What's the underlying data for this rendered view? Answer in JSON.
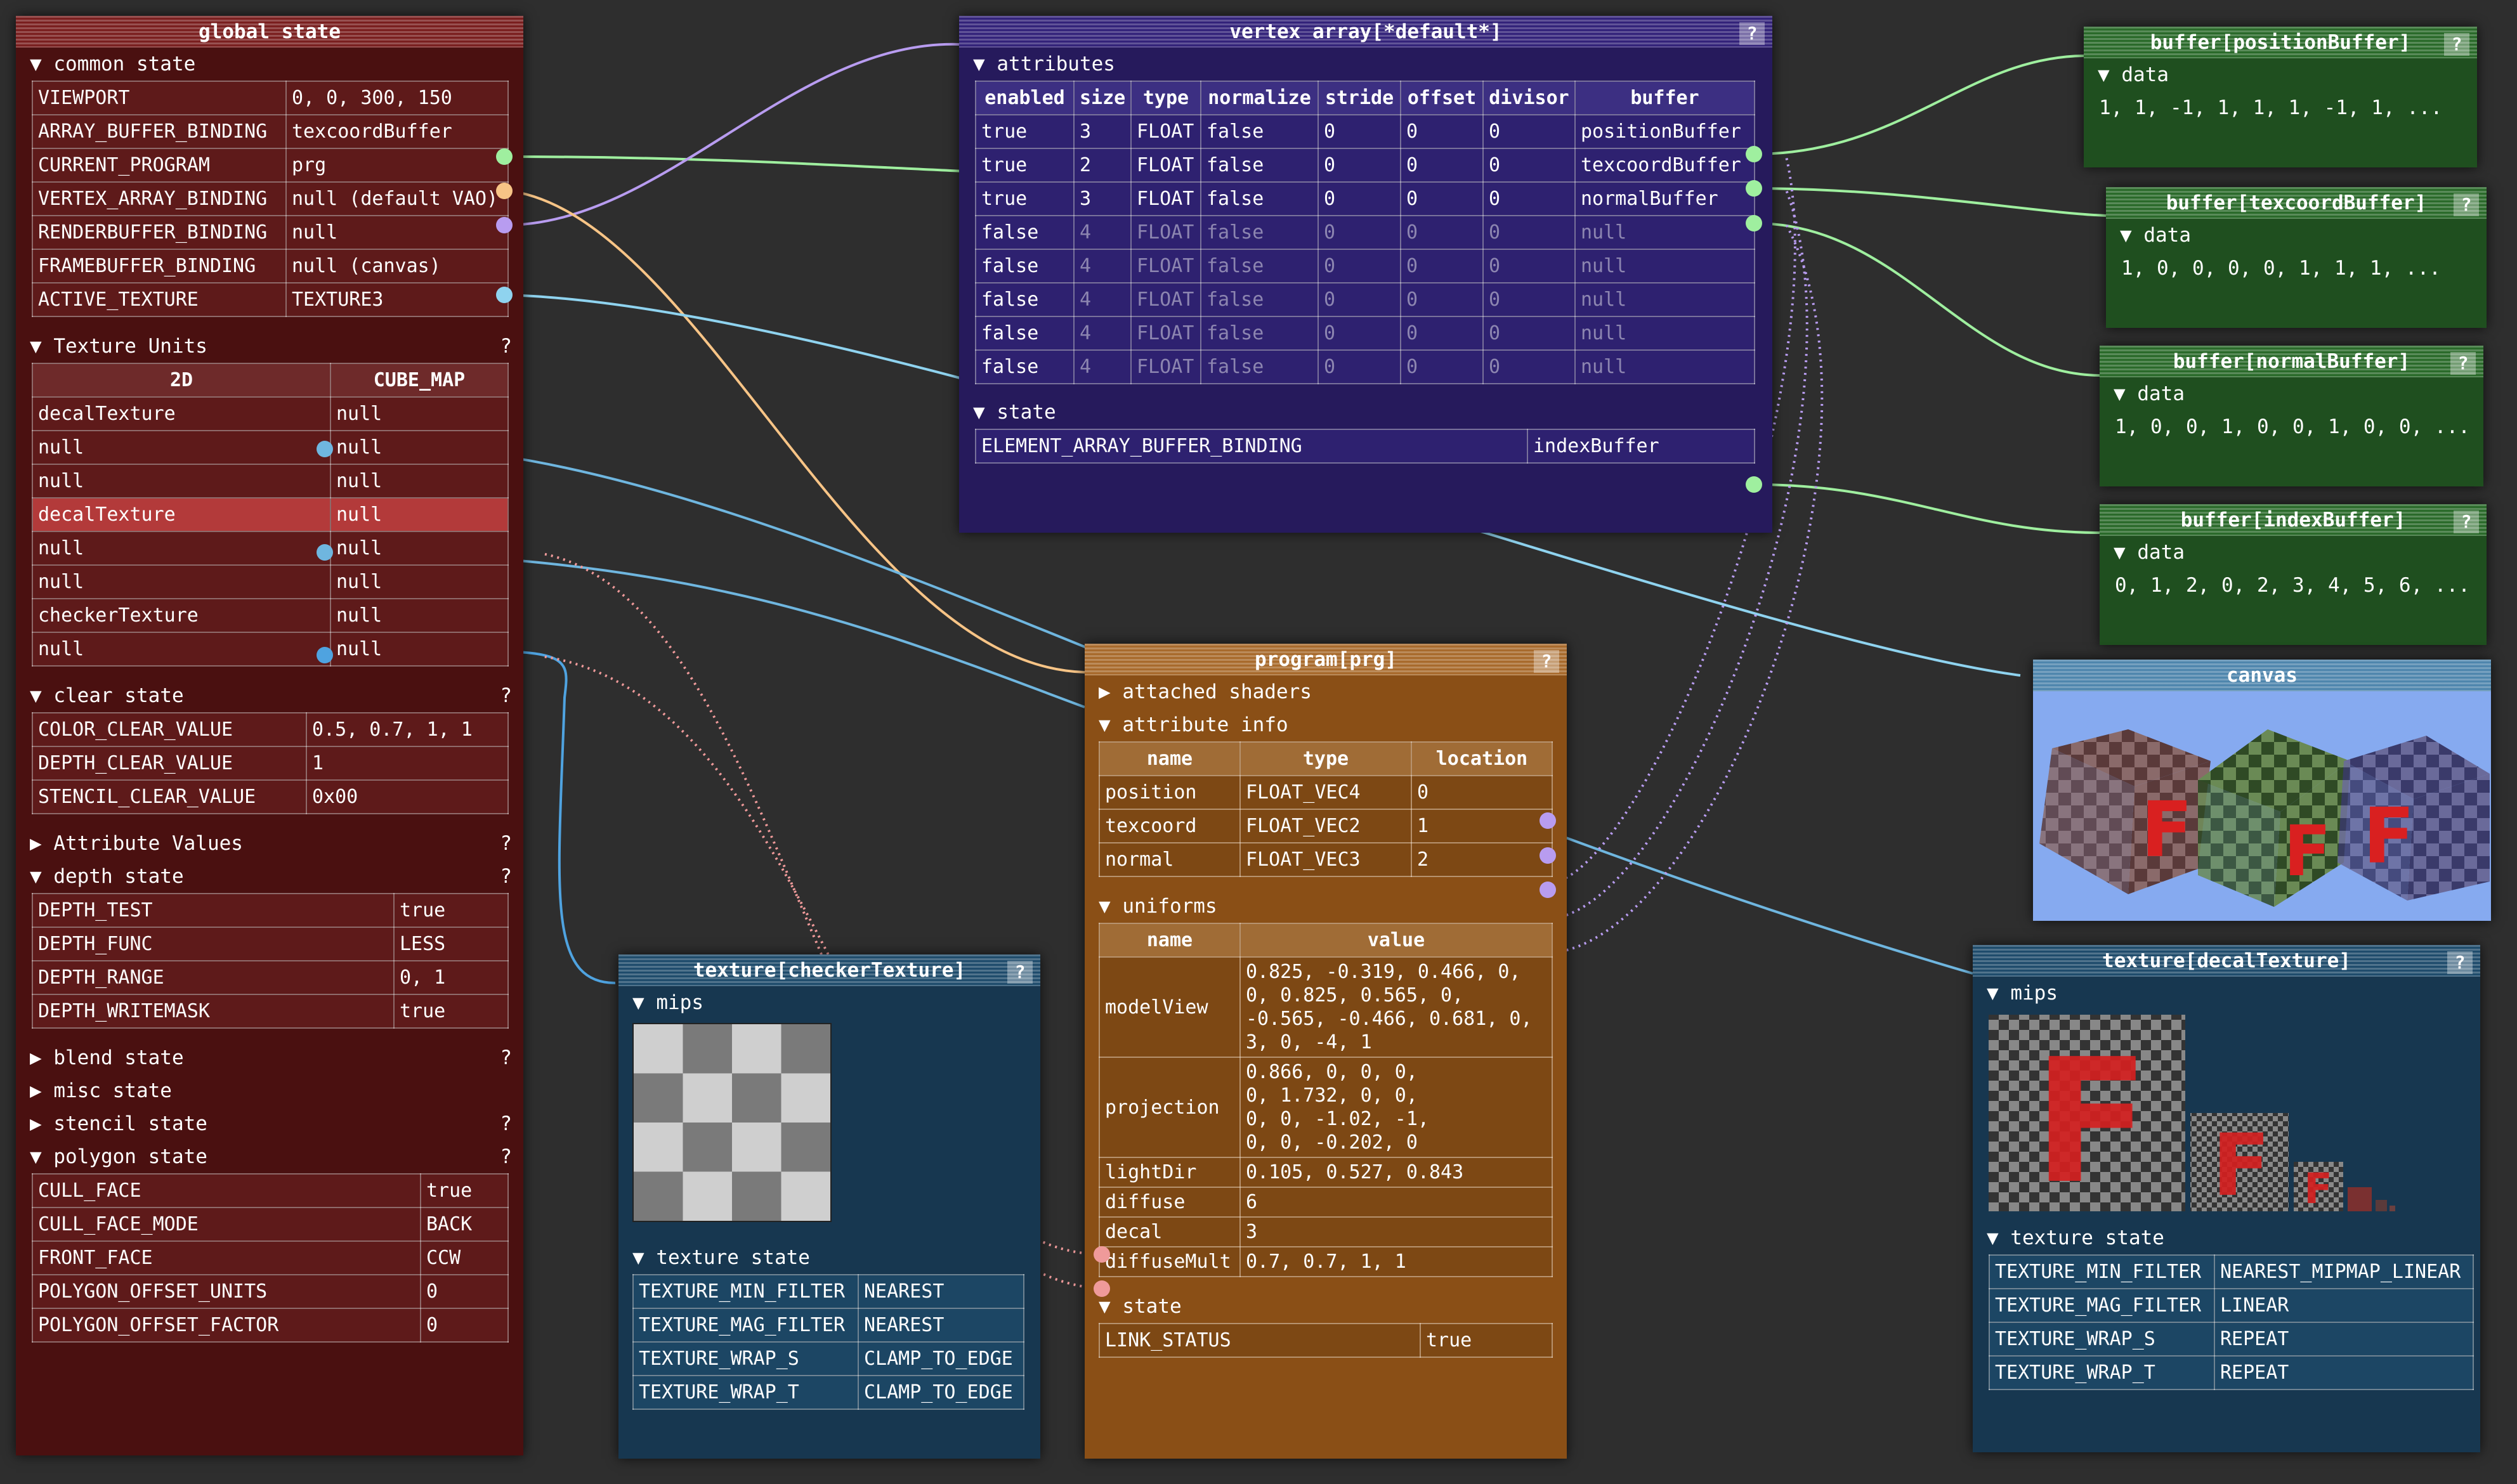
{
  "global_state": {
    "title": "global state",
    "help": "?",
    "common_state_label": "common state",
    "common_rows": [
      [
        "VIEWPORT",
        "0, 0, 300, 150"
      ],
      [
        "ARRAY_BUFFER_BINDING",
        "texcoordBuffer"
      ],
      [
        "CURRENT_PROGRAM",
        "prg"
      ],
      [
        "VERTEX_ARRAY_BINDING",
        "null (default VAO)"
      ],
      [
        "RENDERBUFFER_BINDING",
        "null"
      ],
      [
        "FRAMEBUFFER_BINDING",
        "null (canvas)"
      ],
      [
        "ACTIVE_TEXTURE",
        "TEXTURE3"
      ]
    ],
    "texture_units_label": "Texture Units",
    "texture_unit_headers": [
      "2D",
      "CUBE_MAP"
    ],
    "texture_units": [
      [
        "decalTexture",
        "null"
      ],
      [
        "null",
        "null"
      ],
      [
        "null",
        "null"
      ],
      [
        "decalTexture",
        "null"
      ],
      [
        "null",
        "null"
      ],
      [
        "null",
        "null"
      ],
      [
        "checkerTexture",
        "null"
      ],
      [
        "null",
        "null"
      ]
    ],
    "clear_state_label": "clear state",
    "clear_rows": [
      [
        "COLOR_CLEAR_VALUE",
        "0.5, 0.7, 1, 1"
      ],
      [
        "DEPTH_CLEAR_VALUE",
        "1"
      ],
      [
        "STENCIL_CLEAR_VALUE",
        "0x00"
      ]
    ],
    "attribute_values_label": "Attribute Values",
    "depth_state_label": "depth state",
    "depth_rows": [
      [
        "DEPTH_TEST",
        "true"
      ],
      [
        "DEPTH_FUNC",
        "LESS"
      ],
      [
        "DEPTH_RANGE",
        "0, 1"
      ],
      [
        "DEPTH_WRITEMASK",
        "true"
      ]
    ],
    "blend_state_label": "blend state",
    "misc_state_label": "misc state",
    "stencil_state_label": "stencil state",
    "polygon_state_label": "polygon state",
    "polygon_rows": [
      [
        "CULL_FACE",
        "true"
      ],
      [
        "CULL_FACE_MODE",
        "BACK"
      ],
      [
        "FRONT_FACE",
        "CCW"
      ],
      [
        "POLYGON_OFFSET_UNITS",
        "0"
      ],
      [
        "POLYGON_OFFSET_FACTOR",
        "0"
      ]
    ]
  },
  "vertex_array": {
    "title": "vertex array[*default*]",
    "help": "?",
    "attributes_label": "attributes",
    "headers": [
      "enabled",
      "size",
      "type",
      "normalize",
      "stride",
      "offset",
      "divisor",
      "buffer"
    ],
    "rows": [
      [
        "true",
        "3",
        "FLOAT",
        "false",
        "0",
        "0",
        "0",
        "positionBuffer"
      ],
      [
        "true",
        "2",
        "FLOAT",
        "false",
        "0",
        "0",
        "0",
        "texcoordBuffer"
      ],
      [
        "true",
        "3",
        "FLOAT",
        "false",
        "0",
        "0",
        "0",
        "normalBuffer"
      ],
      [
        "false",
        "4",
        "FLOAT",
        "false",
        "0",
        "0",
        "0",
        "null"
      ],
      [
        "false",
        "4",
        "FLOAT",
        "false",
        "0",
        "0",
        "0",
        "null"
      ],
      [
        "false",
        "4",
        "FLOAT",
        "false",
        "0",
        "0",
        "0",
        "null"
      ],
      [
        "false",
        "4",
        "FLOAT",
        "false",
        "0",
        "0",
        "0",
        "null"
      ],
      [
        "false",
        "4",
        "FLOAT",
        "false",
        "0",
        "0",
        "0",
        "null"
      ]
    ],
    "state_label": "state",
    "state_row": [
      "ELEMENT_ARRAY_BUFFER_BINDING",
      "indexBuffer"
    ]
  },
  "buffers": [
    {
      "title": "buffer[positionBuffer]",
      "help": "?",
      "data_label": "data",
      "data": "1, 1, -1, 1, 1, 1, -1, 1, ..."
    },
    {
      "title": "buffer[texcoordBuffer]",
      "help": "?",
      "data_label": "data",
      "data": "1, 0, 0, 0, 0, 1, 1, 1, ..."
    },
    {
      "title": "buffer[normalBuffer]",
      "help": "?",
      "data_label": "data",
      "data": "1, 0, 0, 1, 0, 0, 1, 0, 0, ..."
    },
    {
      "title": "buffer[indexBuffer]",
      "help": "?",
      "data_label": "data",
      "data": "0, 1, 2, 0, 2, 3, 4, 5, 6, ..."
    }
  ],
  "canvas": {
    "title": "canvas"
  },
  "checker_texture": {
    "title": "texture[checkerTexture]",
    "help": "?",
    "mips_label": "mips",
    "state_label": "texture state",
    "rows": [
      [
        "TEXTURE_MIN_FILTER",
        "NEAREST"
      ],
      [
        "TEXTURE_MAG_FILTER",
        "NEAREST"
      ],
      [
        "TEXTURE_WRAP_S",
        "CLAMP_TO_EDGE"
      ],
      [
        "TEXTURE_WRAP_T",
        "CLAMP_TO_EDGE"
      ]
    ]
  },
  "program": {
    "title": "program[prg]",
    "help": "?",
    "attached_shaders_label": "attached shaders",
    "attribute_info_label": "attribute info",
    "attr_headers": [
      "name",
      "type",
      "location"
    ],
    "attr_rows": [
      [
        "position",
        "FLOAT_VEC4",
        "0"
      ],
      [
        "texcoord",
        "FLOAT_VEC2",
        "1"
      ],
      [
        "normal",
        "FLOAT_VEC3",
        "2"
      ]
    ],
    "uniforms_label": "uniforms",
    "uniform_headers": [
      "name",
      "value"
    ],
    "uniform_rows": [
      [
        "modelView",
        "0.825, -0.319, 0.466, 0,\n0, 0.825, 0.565, 0,\n-0.565, -0.466, 0.681, 0,\n3, 0, -4, 1"
      ],
      [
        "projection",
        "0.866, 0, 0, 0,\n0, 1.732, 0, 0,\n0, 0, -1.02, -1,\n0, 0, -0.202, 0"
      ],
      [
        "lightDir",
        "0.105, 0.527, 0.843"
      ],
      [
        "diffuse",
        "6"
      ],
      [
        "decal",
        "3"
      ],
      [
        "diffuseMult",
        "0.7, 0.7, 1, 1"
      ]
    ],
    "state_label": "state",
    "state_row": [
      "LINK_STATUS",
      "true"
    ]
  },
  "decal_texture": {
    "title": "texture[decalTexture]",
    "help": "?",
    "mips_label": "mips",
    "state_label": "texture state",
    "rows": [
      [
        "TEXTURE_MIN_FILTER",
        "NEAREST_MIPMAP_LINEAR"
      ],
      [
        "TEXTURE_MAG_FILTER",
        "LINEAR"
      ],
      [
        "TEXTURE_WRAP_S",
        "REPEAT"
      ],
      [
        "TEXTURE_WRAP_T",
        "REPEAT"
      ]
    ]
  },
  "colors": {
    "position": "#9fef9f",
    "wire_purple": "#b89cf0",
    "wire_orange": "#f7c486",
    "wire_blue": "#7ec8ef",
    "wire_pink": "#ef9a9a"
  }
}
